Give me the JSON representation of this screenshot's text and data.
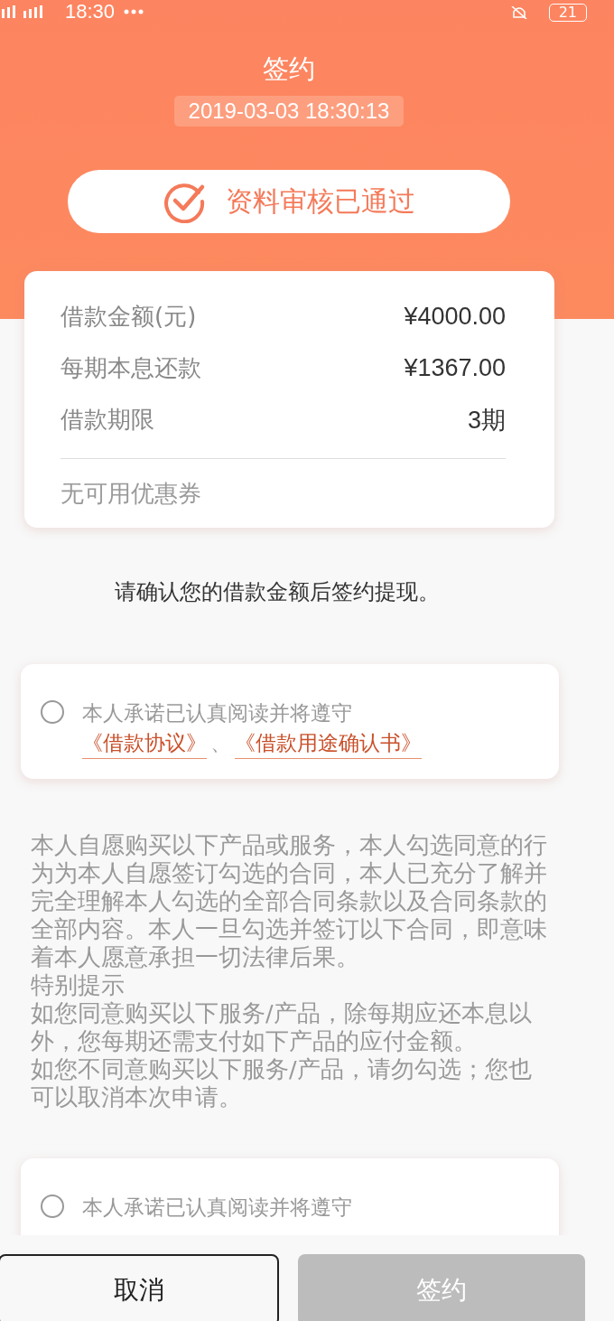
{
  "status_bar": {
    "time": "18:30",
    "battery": "21"
  },
  "header": {
    "title": "签约",
    "datetime": "2019-03-03 18:30:13",
    "status": "资料审核已通过"
  },
  "loan_card": {
    "rows": [
      {
        "label": "借款金额(元)",
        "value": "¥4000.00"
      },
      {
        "label": "每期本息还款",
        "value": "¥1367.00"
      },
      {
        "label": "借款期限",
        "value": "3期"
      }
    ],
    "coupon": "无可用优惠券"
  },
  "confirm_text": "请确认您的借款金额后签约提现。",
  "agreements": [
    {
      "checked": false,
      "text": "本人承诺已认真阅读并将遵守",
      "links": [
        "《借款协议》",
        "《借款用途确认书》"
      ],
      "separator": "、"
    }
  ],
  "notice": [
    "本人自愿购买以下产品或服务，本人勾选同意的行为为本人自愿签订勾选的合同，本人已充分了解并完全理解本人勾选的全部合同条款以及合同条款的全部内容。本人一旦勾选并签订以下合同，即意味着本人愿意承担一切法律后果。",
    "特别提示",
    "如您同意购买以下服务/产品，除每期应还本息以外，您每期还需支付如下产品的应付金额。",
    "如您不同意购买以下服务/产品，请勿勾选；您也可以取消本次申请。"
  ],
  "agreements_2": [
    {
      "checked": false,
      "text": "本人承诺已认真阅读并将遵守"
    }
  ],
  "buttons": [
    {
      "label": "取消",
      "disabled": false
    },
    {
      "label": "签约",
      "disabled": true
    }
  ]
}
